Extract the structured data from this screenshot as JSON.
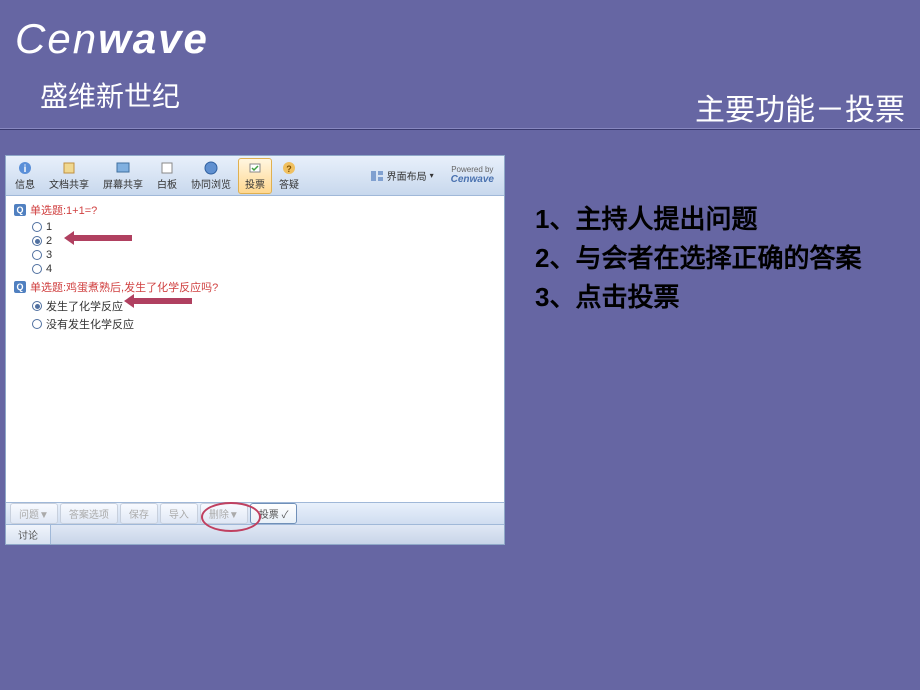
{
  "brand": {
    "cen": "Cen",
    "wave": "wave",
    "subtitle": "盛维新世纪"
  },
  "page_title": "主要功能－投票",
  "toolbar": {
    "items": [
      {
        "label": "信息"
      },
      {
        "label": "文档共享"
      },
      {
        "label": "屏幕共享"
      },
      {
        "label": "白板"
      },
      {
        "label": "协同浏览"
      },
      {
        "label": "投票"
      },
      {
        "label": "答疑"
      }
    ],
    "layout_btn": "界面布局",
    "powered": "Powered by",
    "powered_brand": "Cenwave"
  },
  "poll": {
    "q1": {
      "prefix": "Q",
      "text": "单选题:1+1=?"
    },
    "q1_opts": [
      "1",
      "2",
      "3",
      "4"
    ],
    "q2": {
      "prefix": "Q",
      "text": "单选题:鸡蛋煮熟后,发生了化学反应吗?"
    },
    "q2_opts": [
      "发生了化学反应",
      "没有发生化学反应"
    ]
  },
  "bottom_bar": {
    "b1": "问题▼",
    "b2": "答案选项",
    "b3": "保存",
    "b4": "导入",
    "b5": "删除▼",
    "vote": "投票 ✓"
  },
  "chat_tab": "讨论",
  "instructions": {
    "l1": "1、主持人提出问题",
    "l2": "2、与会者在选择正确的答案",
    "l3": "3、点击投票"
  }
}
